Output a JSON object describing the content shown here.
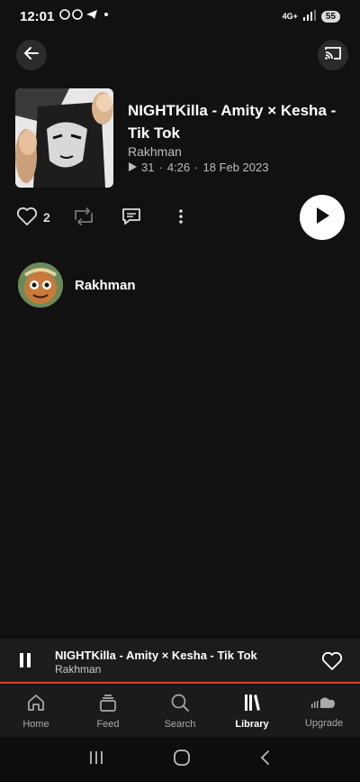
{
  "status_bar": {
    "time": "12:01",
    "network": "4G+",
    "battery": "55"
  },
  "track": {
    "title": "NIGHTKilla - Amity × Kesha - Tik Tok",
    "artist": "Rakhman",
    "plays": "31",
    "duration": "4:26",
    "date": "18 Feb 2023",
    "meta_separator": "·"
  },
  "actions": {
    "likes_count": "2"
  },
  "uploader": {
    "name": "Rakhman"
  },
  "mini_player": {
    "title": "NIGHTKilla - Amity × Kesha - Tik Tok",
    "artist": "Rakhman"
  },
  "nav": {
    "items": [
      {
        "label": "Home"
      },
      {
        "label": "Feed"
      },
      {
        "label": "Search"
      },
      {
        "label": "Library"
      },
      {
        "label": "Upgrade"
      }
    ],
    "active": "Library"
  },
  "colors": {
    "background": "#111111",
    "accent": "#e0431f",
    "text_secondary": "#bdbdbd"
  }
}
